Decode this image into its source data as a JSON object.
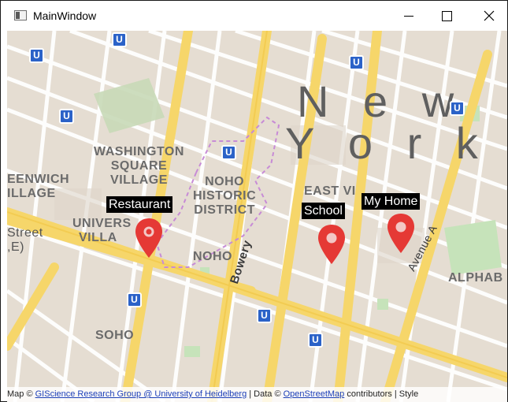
{
  "window": {
    "title": "MainWindow",
    "controls": {
      "minimize": "minimize",
      "maximize": "maximize",
      "close": "close"
    }
  },
  "map": {
    "city_label_line1": "N e w",
    "city_label_line2": "Y o r k",
    "neighborhoods": [
      {
        "id": "washington-square-village",
        "lines": [
          "WASHINGTON",
          "SQUARE",
          "VILLAGE"
        ]
      },
      {
        "id": "noho-historic-district",
        "lines": [
          "NOHO",
          "HISTORIC",
          "DISTRICT"
        ]
      },
      {
        "id": "greenwich-village",
        "lines": [
          "EENWICH",
          "ILLAGE"
        ]
      },
      {
        "id": "university-village",
        "lines": [
          "UNIVERS",
          "VILLA"
        ]
      },
      {
        "id": "east-village",
        "lines": [
          "EAST VI"
        ]
      },
      {
        "id": "noho",
        "lines": [
          "NOHO"
        ]
      },
      {
        "id": "soho",
        "lines": [
          "SOHO"
        ]
      },
      {
        "id": "alphabet-city",
        "lines": [
          "ALPHAB"
        ]
      },
      {
        "id": "street-e",
        "lines": [
          "Street",
          ",E)"
        ]
      }
    ],
    "street_labels": {
      "bowery": "Bowery",
      "avenue_a": "Avenue A"
    },
    "markers": [
      {
        "id": "restaurant",
        "label": "Restaurant"
      },
      {
        "id": "school",
        "label": "School"
      },
      {
        "id": "my-home",
        "label": "My Home"
      }
    ],
    "metro_symbol": "U",
    "colors": {
      "marker": "#e53935",
      "road_major": "#f8d96b",
      "metro": "#2b62c8",
      "park": "#cfe5bf",
      "land": "#e5ddd2"
    }
  },
  "attribution": {
    "prefix": "Map © ",
    "provider": "GIScience Research Group @ University of Heidelberg",
    "middle": " | Data © ",
    "osm": "OpenStreetMap",
    "suffix": " contributors | Style"
  }
}
